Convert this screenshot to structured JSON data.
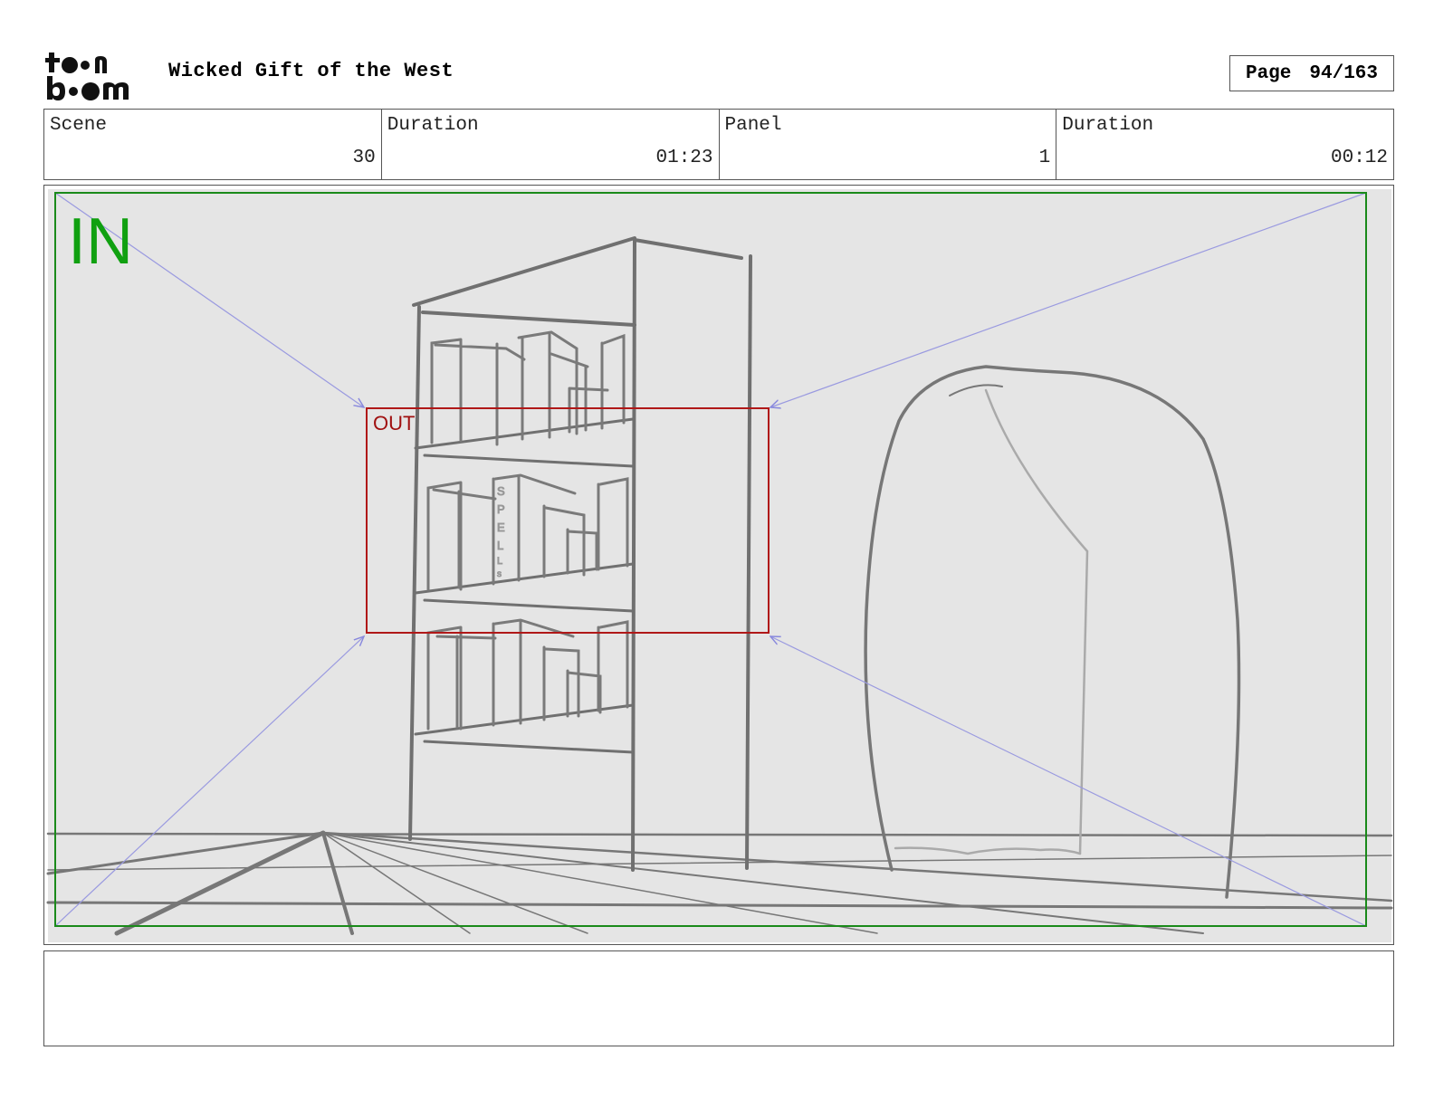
{
  "header": {
    "logo_text": "toon boom",
    "title": "Wicked Gift of the West",
    "page_label": "Page",
    "page_value": "94/163"
  },
  "info": [
    {
      "label": "Scene",
      "value": "30"
    },
    {
      "label": "Duration",
      "value": "01:23"
    },
    {
      "label": "Panel",
      "value": "1"
    },
    {
      "label": "Duration",
      "value": "00:12"
    }
  ],
  "panel": {
    "in_label": "IN",
    "out_label": "OUT",
    "book_spine_text": "SPELLS",
    "colors": {
      "in_frame": "#1a8a1a",
      "out_frame": "#b01818",
      "camera_arrows": "#8888dd",
      "sketch": "#777777",
      "background": "#e5e5e5"
    }
  },
  "notes": {
    "text": ""
  }
}
